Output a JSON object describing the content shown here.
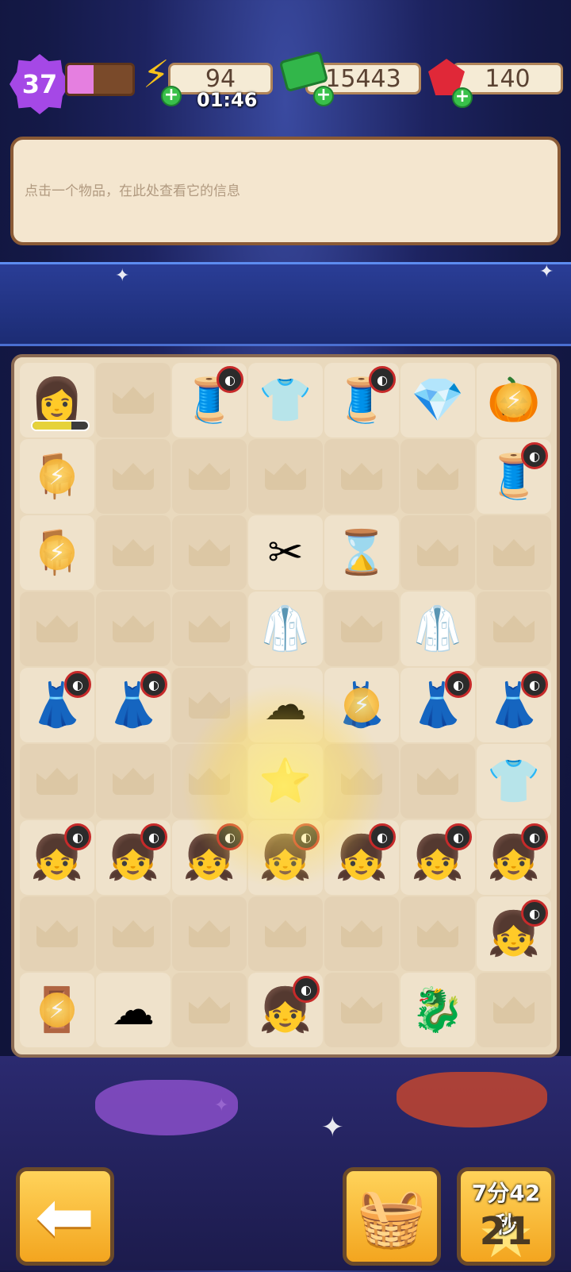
{
  "hud": {
    "level": "37",
    "xp_progress": 0.4,
    "energy": "94",
    "energy_timer": "01:46",
    "cash": "15443",
    "gems": "140"
  },
  "info_panel": {
    "text": "点击一个物品，在此处查看它的信息"
  },
  "board": {
    "cells": [
      [
        "seamstress-girl",
        "",
        "sewing-machine",
        "black-tshirt-jeans",
        "sewing-machine",
        "blue-crystal",
        "golden-carriage"
      ],
      [
        "sewing-desk-gold",
        "",
        "",
        "",
        "",
        "",
        "sewing-machine"
      ],
      [
        "wood-desk",
        "",
        "",
        "thread-scissors",
        "hourglass-token",
        "",
        ""
      ],
      [
        "",
        "",
        "",
        "green-jumpsuit",
        "",
        "green-jumpsuit",
        ""
      ],
      [
        "dress-mannequin",
        "pink-princess-dress",
        "",
        "pink-cloud-shell",
        "mint-ball-gown-glowing",
        "mint-ball-gown",
        "mint-ball-gown"
      ],
      [
        "",
        "",
        "",
        "green-star-angel",
        "",
        "",
        "black-tshirt-jeans"
      ],
      [
        "girl-pastel-dress",
        "girl-aqua-bows",
        "girl-maid",
        "girl-yellow-top",
        "girl-yellow-shirt",
        "girl-red-star",
        "girl-white-shirt"
      ],
      [
        "",
        "",
        "",
        "",
        "",
        "",
        "girl-white-shirt"
      ],
      [
        "wardrobe-gold",
        "pink-cloud-gift",
        "",
        "girl-white-shirt",
        "",
        "pink-dragon-cloud",
        ""
      ]
    ]
  },
  "buttons": {
    "countdown": "7分42秒",
    "star_count": "21"
  },
  "colors": {
    "panel_bg": "#f4e6cf",
    "board_bg": "#e9d9bd",
    "button_yellow": "#f3a51f",
    "level_purple": "#a548e6"
  }
}
